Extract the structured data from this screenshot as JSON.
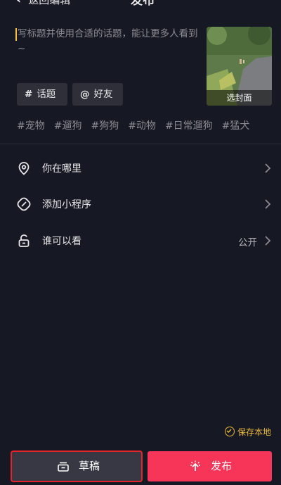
{
  "header": {
    "back_label": "返回编辑",
    "title": "发布"
  },
  "caption": {
    "placeholder": "写标题并使用合适的话题，能让更多人看到 ~"
  },
  "cover": {
    "label": "选封面"
  },
  "chips": {
    "topic_symbol": "#",
    "topic_label": "话题",
    "friend_symbol": "@",
    "friend_label": "好友"
  },
  "tags": [
    "#宠物",
    "#遛狗",
    "#狗狗",
    "#动物",
    "#日常遛狗",
    "#猛犬"
  ],
  "settings": {
    "location_label": "你在哪里",
    "mini_program_label": "添加小程序",
    "visibility_label": "谁可以看",
    "visibility_value": "公开"
  },
  "save_local_label": "保存本地",
  "buttons": {
    "draft_label": "草稿",
    "publish_label": "发布"
  },
  "colors": {
    "background": "#161823",
    "accent_publish": "#f63558",
    "save_local": "#e9b93b",
    "highlight_box": "#e5232b"
  }
}
